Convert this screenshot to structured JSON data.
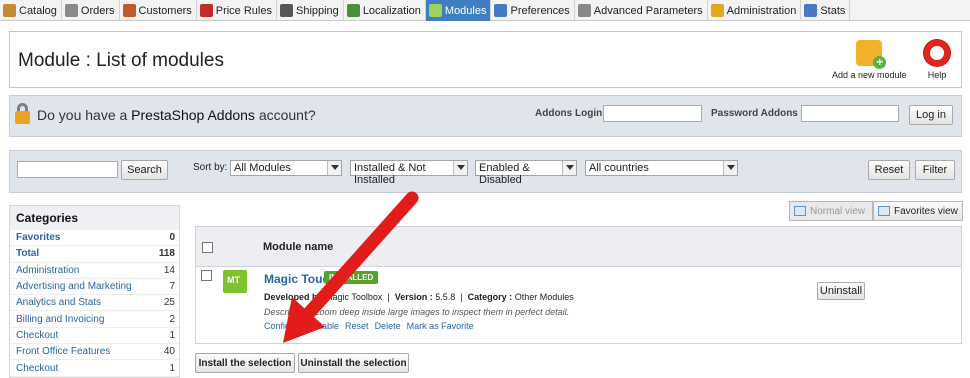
{
  "nav": {
    "tabs": [
      {
        "label": "Catalog",
        "icon": "catalog-icon",
        "color": "#c48b2c"
      },
      {
        "label": "Orders",
        "icon": "cart-icon",
        "color": "#8a8a8a"
      },
      {
        "label": "Customers",
        "icon": "customers-icon",
        "color": "#c4572c"
      },
      {
        "label": "Price Rules",
        "icon": "price-rules-icon",
        "color": "#c42c2c"
      },
      {
        "label": "Shipping",
        "icon": "truck-icon",
        "color": "#555555"
      },
      {
        "label": "Localization",
        "icon": "globe-icon",
        "color": "#4a8f3a"
      },
      {
        "label": "Modules",
        "icon": "puzzle-icon",
        "color": "#9fd25c",
        "active": true
      },
      {
        "label": "Preferences",
        "icon": "preferences-icon",
        "color": "#4a78c4"
      },
      {
        "label": "Advanced Parameters",
        "icon": "wrench-icon",
        "color": "#888888"
      },
      {
        "label": "Administration",
        "icon": "key-icon",
        "color": "#e0a820"
      },
      {
        "label": "Stats",
        "icon": "stats-icon",
        "color": "#4a78c4"
      }
    ]
  },
  "header": {
    "title": "Module : List of modules",
    "add_module_label": "Add a new module",
    "help_label": "Help"
  },
  "addons": {
    "question_prefix": "Do you have a ",
    "question_brand": "PrestaShop Addons",
    "question_suffix": " account?",
    "login_label": "Addons Login :",
    "password_label": "Password Addons :",
    "login_button": "Log in",
    "login_value": "",
    "password_value": ""
  },
  "filters": {
    "search_value": "",
    "search_button": "Search",
    "sort_label": "Sort by:",
    "sort_modules": "All Modules",
    "sort_installed": "Installed & Not Installed",
    "sort_enabled": "Enabled & Disabled",
    "sort_country": "All countries",
    "reset_button": "Reset",
    "filter_button": "Filter"
  },
  "categories": {
    "title": "Categories",
    "items": [
      {
        "label": "Favorites",
        "count": "0",
        "bold": true
      },
      {
        "label": "Total",
        "count": "118",
        "bold": true
      },
      {
        "label": "Administration",
        "count": "14"
      },
      {
        "label": "Advertising and Marketing",
        "count": "7"
      },
      {
        "label": "Analytics and Stats",
        "count": "25"
      },
      {
        "label": "Billing and Invoicing",
        "count": "2"
      },
      {
        "label": "Checkout",
        "count": "1"
      },
      {
        "label": "Front Office Features",
        "count": "40"
      },
      {
        "label": "Checkout",
        "count": "1"
      }
    ]
  },
  "view": {
    "normal_label": "Normal view",
    "favorites_label": "Favorites view"
  },
  "table": {
    "column_header": "Module name",
    "module": {
      "name": "Magic Touch",
      "status_badge": "INSTALLED",
      "developer_label": "Developed by",
      "developer": "Magic Toolbox",
      "version_label": "Version :",
      "version": "5.5.8",
      "category_label": "Category :",
      "category": "Other Modules",
      "description": "Description: Zoom deep inside large images to inspect them in perfect detail.",
      "actions": [
        "Configure",
        "Disable",
        "Reset",
        "Delete",
        "Mark as Favorite"
      ],
      "uninstall_button": "Uninstall"
    }
  },
  "bottom": {
    "install_selection": "Install the selection",
    "uninstall_selection": "Uninstall the selection"
  },
  "annotation": {
    "arrow_color": "#e21b1b"
  }
}
